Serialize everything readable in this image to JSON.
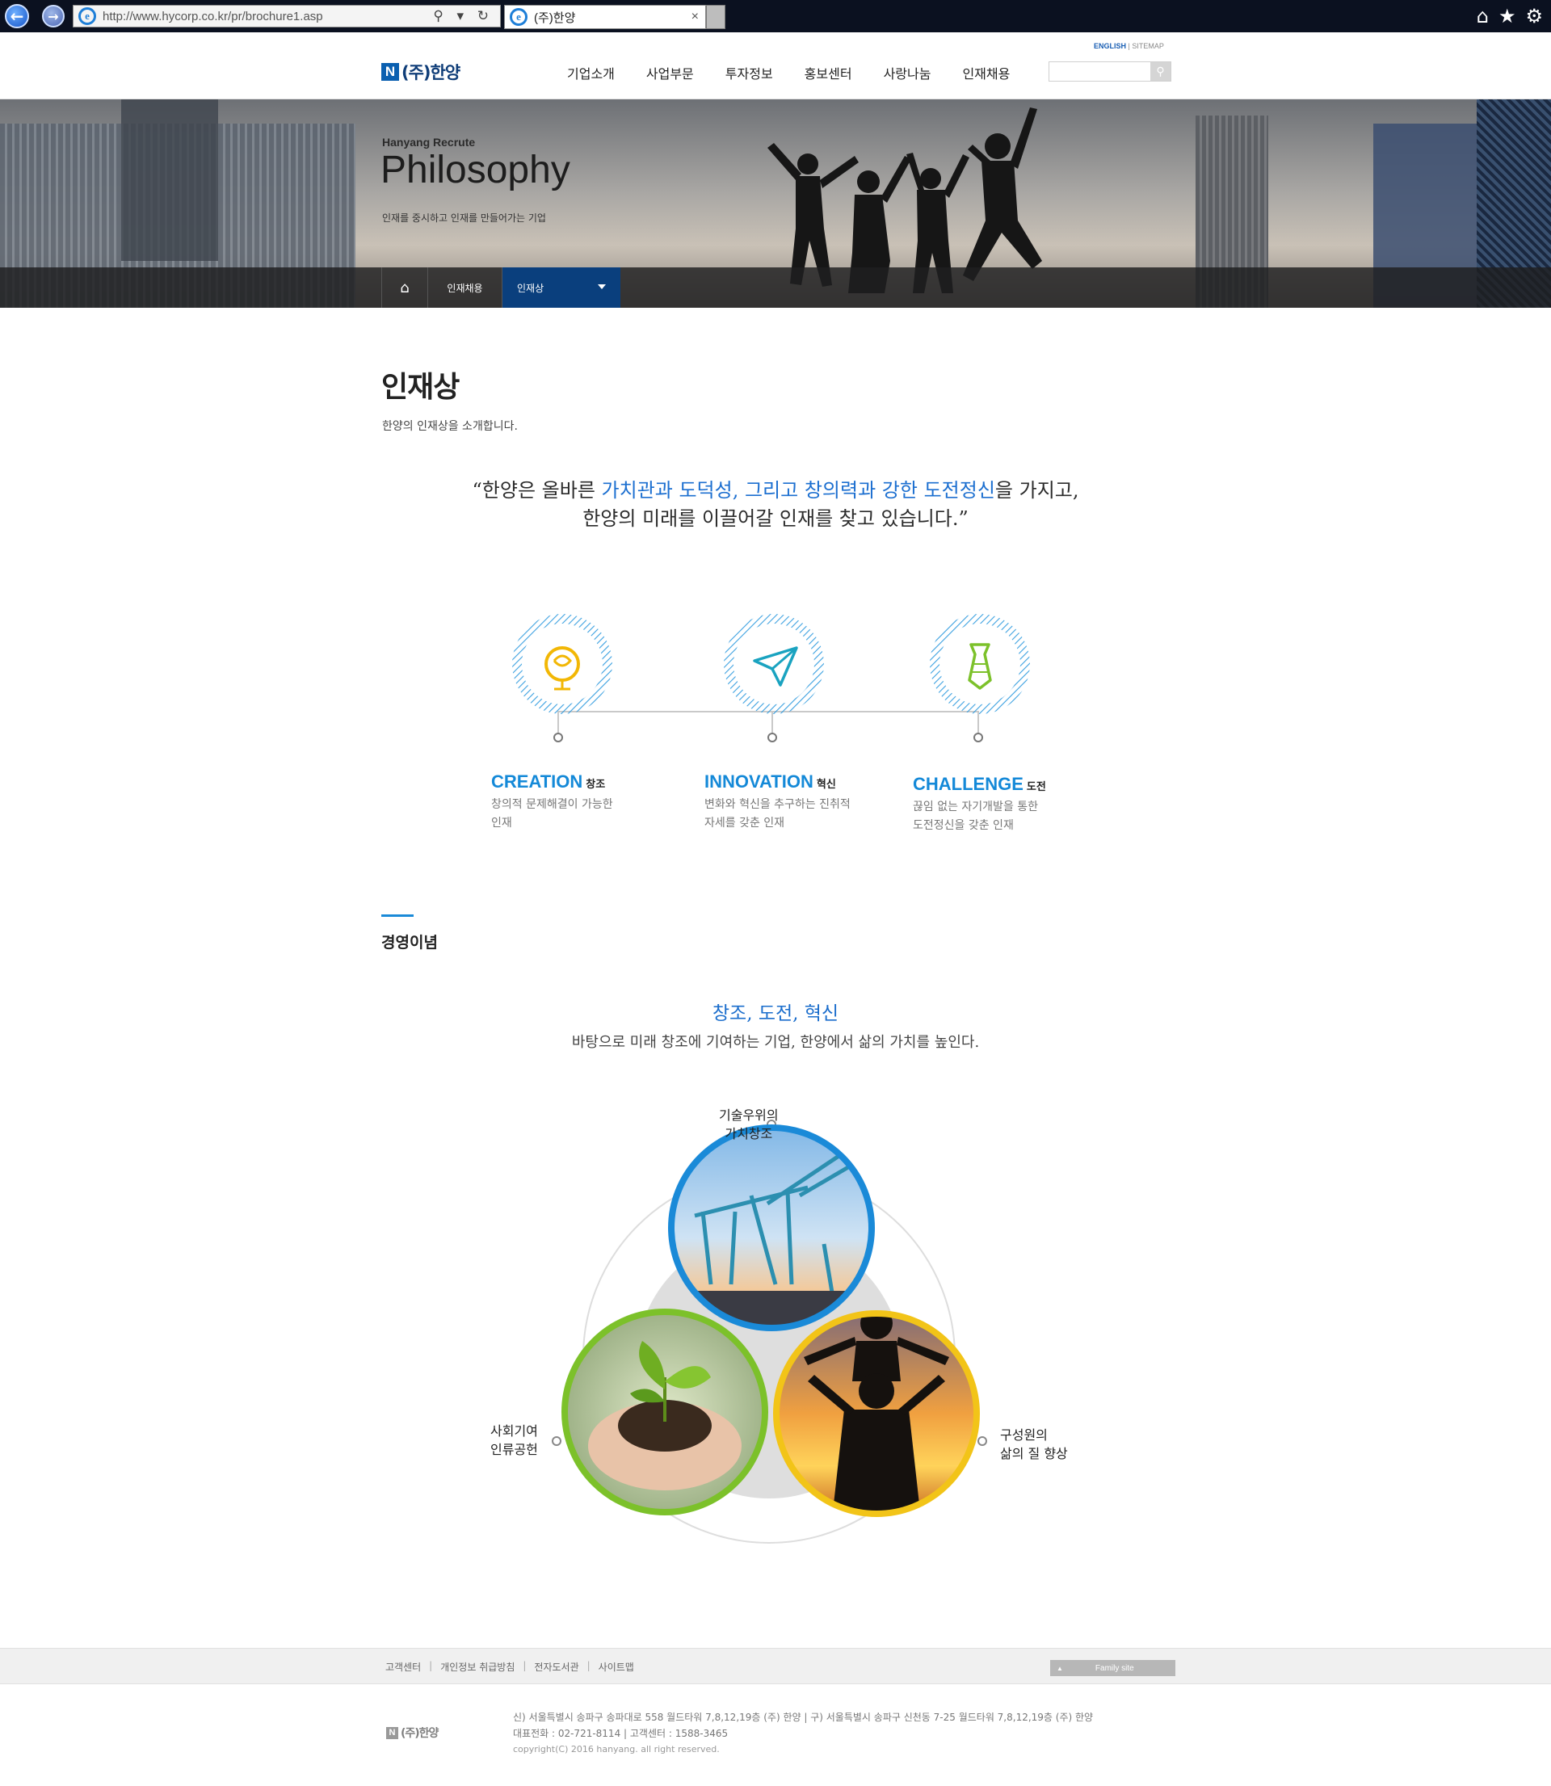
{
  "browser": {
    "url": "http://www.hycorp.co.kr/pr/brochure1.asp",
    "tab_title": "(주)한양",
    "close_glyph": "×"
  },
  "header": {
    "util_english": "ENGLISH",
    "util_sitemap": "SITEMAP",
    "logo_mark": "N",
    "logo_text": "(주)한양",
    "nav": [
      "기업소개",
      "사업부문",
      "투자정보",
      "홍보센터",
      "사랑나눔",
      "인재채용"
    ],
    "search_placeholder": ""
  },
  "hero": {
    "subtitle": "Hanyang Recrute",
    "title": "Philosophy",
    "desc": "인재를 중시하고 인재를 만들어가는 기업",
    "breadcrumb": [
      "인재채용",
      "인재상"
    ]
  },
  "content": {
    "page_title": "인재상",
    "page_desc": "한양의 인재상을 소개합니다.",
    "quote": {
      "part1": "“한양은 올바른 ",
      "highlight1": "가치관과 도덕성, 그리고 창의력과 강한 도전정신",
      "part2": "을 가지고,",
      "line2": "한양의 미래를 이끌어갈 인재를 찾고 있습니다.”"
    },
    "talents": [
      {
        "name": "CREATION",
        "kr": "창조",
        "desc1": "창의적 문제해결이 가능한",
        "desc2": "인재",
        "color": "#1489d8"
      },
      {
        "name": "INNOVATION",
        "kr": "혁신",
        "desc1": "변화와 혁신을 추구하는 진취적",
        "desc2": "자세를 갖춘 인재",
        "color": "#1489d8"
      },
      {
        "name": "CHALLENGE",
        "kr": "도전",
        "desc1": "끊임 없는 자기개발을 통한",
        "desc2": "도전정신을 갖춘 인재",
        "color": "#1489d8"
      }
    ],
    "mission_section_title": "경영이념",
    "mission_title": "창조, 도전, 혁신",
    "mission_desc": "바탕으로 미래 창조에 기여하는 기업, 한양에서 삶의 가치를 높인다.",
    "venn": {
      "top": [
        "기술우위의",
        "가치창조"
      ],
      "left": [
        "사회기여",
        "인류공헌"
      ],
      "right": [
        "구성원의",
        "삶의 질 향상"
      ],
      "colors": {
        "top": "#1a8ad8",
        "left": "#7cc12a",
        "right": "#f2c418"
      }
    }
  },
  "footer": {
    "links": [
      "고객센터",
      "개인정보 취급방침",
      "전자도서관",
      "사이트맵"
    ],
    "family_site": "Family site",
    "address": "신) 서울특별시 송파구 송파대로 558 월드타워 7,8,12,19층 (주) 한양   |   구) 서울특별시 송파구 신천동 7-25 월드타워 7,8,12,19층 (주) 한양",
    "phone": "대표전화 : 02-721-8114   |   고객센터 : 1588-3465",
    "copyright": "copyright(C) 2016 hanyang. all right reserved."
  }
}
